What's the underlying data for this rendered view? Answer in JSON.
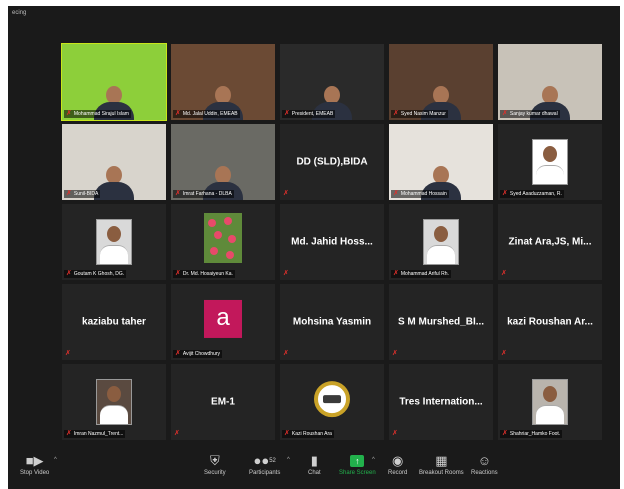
{
  "window": {
    "recording_label": "ecing"
  },
  "tiles": [
    {
      "label": "Mohammad Sirajul Islam",
      "center": "",
      "type": "video-banner",
      "speaking": true
    },
    {
      "label": "Md. Jalal Uddin, EMEAB",
      "center": "",
      "type": "video-office"
    },
    {
      "label": "President, EMEAB",
      "center": "",
      "type": "video-dark"
    },
    {
      "label": "Syed Nasim Manzur",
      "center": "",
      "type": "video-books"
    },
    {
      "label": "Sanjay kumar dhawal",
      "center": "",
      "type": "video-room"
    },
    {
      "label": "Sunil-BIDA",
      "center": "",
      "type": "video-mask"
    },
    {
      "label": "Imrat Farhana - DLBA",
      "center": "",
      "type": "video-hijab"
    },
    {
      "label": "",
      "center": "DD (SLD),BIDA",
      "type": "name"
    },
    {
      "label": "Mohammad Hossain",
      "center": "",
      "type": "video-light"
    },
    {
      "label": "Syed Asaduzzaman, R.",
      "center": "",
      "type": "photo-banner"
    },
    {
      "label": "Goutam K Ghosh, DG.",
      "center": "",
      "type": "photo"
    },
    {
      "label": "Dr. Md. Hosaiyeun Ka.",
      "center": "",
      "type": "flowers"
    },
    {
      "label": "",
      "center": "Md. Jahid Hoss...",
      "type": "name"
    },
    {
      "label": "Mohammad Ariful Rh.",
      "center": "",
      "type": "photo"
    },
    {
      "label": "",
      "center": "Zinat Ara,JS, Mi...",
      "type": "name"
    },
    {
      "label": "",
      "center": "kaziabu taher",
      "type": "name"
    },
    {
      "label": "Avijit Chowdhury",
      "center": "",
      "type": "avatar",
      "avatar_letter": "a"
    },
    {
      "label": "",
      "center": "Mohsina Yasmin",
      "type": "name"
    },
    {
      "label": "",
      "center": "S M Murshed_BI...",
      "type": "name"
    },
    {
      "label": "",
      "center": "kazi Roushan Ar...",
      "type": "name"
    },
    {
      "label": "Imran Nazmul_Trent...",
      "center": "",
      "type": "photo-dark"
    },
    {
      "label": "",
      "center": "EM-1",
      "type": "name"
    },
    {
      "label": "Kazi Roushan Ara",
      "center": "",
      "type": "emblem"
    },
    {
      "label": "",
      "center": "Tres Internation...",
      "type": "name"
    },
    {
      "label": "Shahriar_Hamko Foot.",
      "center": "",
      "type": "photo-light"
    }
  ],
  "toolbar": {
    "stop_video": "Stop Video",
    "security": "Security",
    "participants": "Participants",
    "participants_count": "52",
    "chat": "Chat",
    "share_screen": "Share Screen",
    "record": "Record",
    "breakout_rooms": "Breakout Rooms",
    "reactions": "Reactions"
  },
  "icons": {
    "mic": "mic-muted-icon",
    "video": "video-camera-icon",
    "security": "shield-icon",
    "participants": "people-icon",
    "chat": "chat-bubble-icon",
    "share": "share-screen-icon",
    "record": "record-icon",
    "breakout": "grid-icon",
    "reactions": "smiley-icon"
  },
  "colors": {
    "active_speaker": "#c8e61a",
    "muted_mic": "#e0302c",
    "share_green": "#22b14c",
    "background": "#1a1a1a"
  }
}
